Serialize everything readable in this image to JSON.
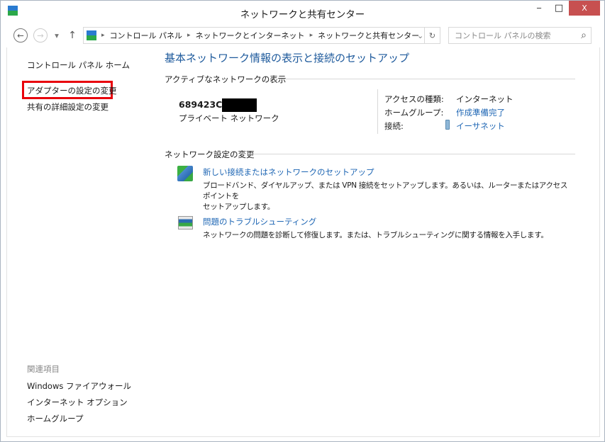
{
  "window": {
    "title": "ネットワークと共有センター",
    "minimize": "‒",
    "maximize": "□",
    "close": "X"
  },
  "nav": {
    "back": "←",
    "forward": "→",
    "recent": "▾",
    "up": "↑",
    "breadcrumb": [
      "コントロール パネル",
      "ネットワークとインターネット",
      "ネットワークと共有センター"
    ],
    "separator": "▸",
    "dropdown": "⌄",
    "refresh": "↻",
    "search_placeholder": "コントロール パネルの検索",
    "search_icon": "⌕"
  },
  "sidebar": {
    "home": "コントロール パネル ホーム",
    "items": [
      "アダプターの設定の変更",
      "共有の詳細設定の変更"
    ],
    "related_heading": "関連項目",
    "related": [
      "Windows ファイアウォール",
      "インターネット オプション",
      "ホームグループ"
    ]
  },
  "main": {
    "title": "基本ネットワーク情報の表示と接続のセットアップ",
    "active_heading": "アクティブなネットワークの表示",
    "network_name": "689423CF",
    "network_type": "プライベート ネットワーク",
    "props": [
      {
        "label": "アクセスの種類:",
        "value": "インターネット"
      },
      {
        "label": "ホームグループ:",
        "value": "作成準備完了"
      },
      {
        "label": "接続:",
        "value": "イーサネット"
      }
    ],
    "settings_heading": "ネットワーク設定の変更",
    "tasks": [
      {
        "link": "新しい接続またはネットワークのセットアップ",
        "desc1": "ブロードバンド、ダイヤルアップ、または VPN 接続をセットアップします。あるいは、ルーターまたはアクセス ポイントを",
        "desc2": "セットアップします。"
      },
      {
        "link": "問題のトラブルシューティング",
        "desc1": "ネットワークの問題を診断して修復します。または、トラブルシューティングに関する情報を入手します。"
      }
    ]
  },
  "colors": {
    "link": "#1e66b4",
    "close": "#c75050",
    "highlight": "#e8000b"
  }
}
